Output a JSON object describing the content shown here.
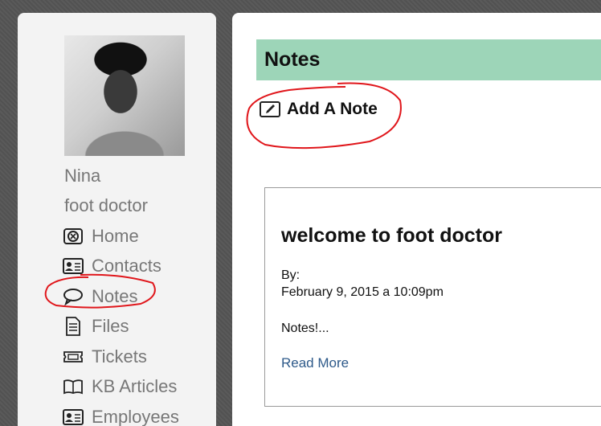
{
  "sidebar": {
    "user_name": "Nina",
    "org_name": "foot doctor",
    "items": [
      {
        "label": "Home",
        "icon": "home-icon"
      },
      {
        "label": "Contacts",
        "icon": "contact-card-icon"
      },
      {
        "label": "Notes",
        "icon": "speech-bubble-icon"
      },
      {
        "label": "Files",
        "icon": "document-icon"
      },
      {
        "label": "Tickets",
        "icon": "ticket-icon"
      },
      {
        "label": "KB Articles",
        "icon": "book-icon"
      },
      {
        "label": "Employees",
        "icon": "employee-card-icon"
      }
    ]
  },
  "main": {
    "title": "Notes",
    "add_note_label": "Add A Note",
    "note": {
      "title": "welcome to foot doctor",
      "by_label": "By:",
      "date": "February 9, 2015 a 10:09pm",
      "excerpt": "Notes!...",
      "read_more": "Read More"
    }
  },
  "colors": {
    "header_bg": "#9dd5b8",
    "annotation": "#e0161b",
    "link": "#2e5a8a"
  }
}
